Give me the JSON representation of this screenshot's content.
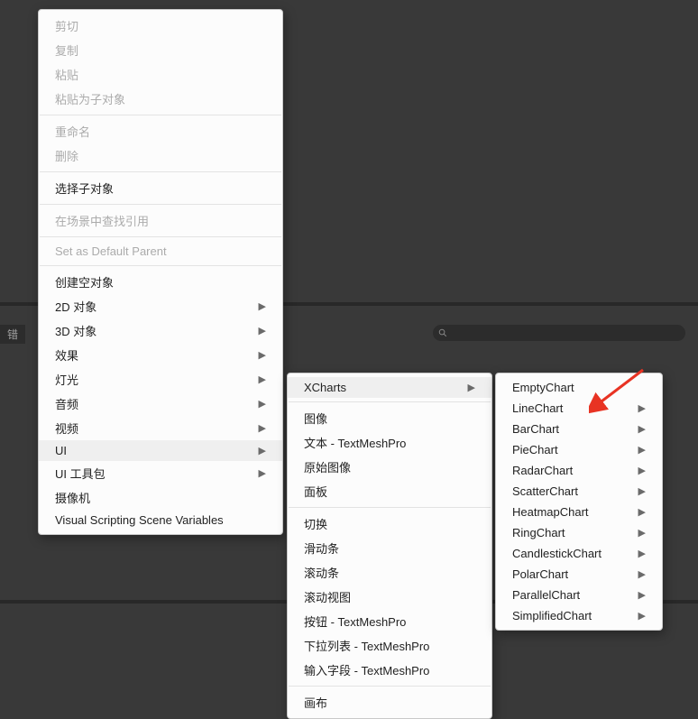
{
  "background": {
    "tab_label": "错",
    "search_placeholder": ""
  },
  "menu1": {
    "groups": [
      [
        {
          "label": "剪切",
          "disabled": true,
          "arrow": false
        },
        {
          "label": "复制",
          "disabled": true,
          "arrow": false
        },
        {
          "label": "粘贴",
          "disabled": true,
          "arrow": false
        },
        {
          "label": "粘贴为子对象",
          "disabled": true,
          "arrow": false
        }
      ],
      [
        {
          "label": "重命名",
          "disabled": true,
          "arrow": false
        },
        {
          "label": "删除",
          "disabled": true,
          "arrow": false
        }
      ],
      [
        {
          "label": "选择子对象",
          "disabled": false,
          "arrow": false
        }
      ],
      [
        {
          "label": "在场景中查找引用",
          "disabled": true,
          "arrow": false
        }
      ],
      [
        {
          "label": "Set as Default Parent",
          "disabled": true,
          "arrow": false
        }
      ],
      [
        {
          "label": "创建空对象",
          "disabled": false,
          "arrow": false
        },
        {
          "label": "2D 对象",
          "disabled": false,
          "arrow": true
        },
        {
          "label": "3D 对象",
          "disabled": false,
          "arrow": true
        },
        {
          "label": "效果",
          "disabled": false,
          "arrow": true
        },
        {
          "label": "灯光",
          "disabled": false,
          "arrow": true
        },
        {
          "label": "音频",
          "disabled": false,
          "arrow": true
        },
        {
          "label": "视频",
          "disabled": false,
          "arrow": true
        },
        {
          "label": "UI",
          "disabled": false,
          "arrow": true,
          "highlight": true
        },
        {
          "label": "UI 工具包",
          "disabled": false,
          "arrow": true
        },
        {
          "label": "摄像机",
          "disabled": false,
          "arrow": false
        },
        {
          "label": "Visual Scripting Scene Variables",
          "disabled": false,
          "arrow": false
        }
      ]
    ]
  },
  "menu2": {
    "groups": [
      [
        {
          "label": "XCharts",
          "disabled": false,
          "arrow": true,
          "highlight": true
        }
      ],
      [
        {
          "label": "图像",
          "disabled": false,
          "arrow": false
        },
        {
          "label": "文本 - TextMeshPro",
          "disabled": false,
          "arrow": false
        },
        {
          "label": "原始图像",
          "disabled": false,
          "arrow": false
        },
        {
          "label": "面板",
          "disabled": false,
          "arrow": false
        }
      ],
      [
        {
          "label": "切换",
          "disabled": false,
          "arrow": false
        },
        {
          "label": "滑动条",
          "disabled": false,
          "arrow": false
        },
        {
          "label": "滚动条",
          "disabled": false,
          "arrow": false
        },
        {
          "label": "滚动视图",
          "disabled": false,
          "arrow": false
        },
        {
          "label": "按钮 - TextMeshPro",
          "disabled": false,
          "arrow": false
        },
        {
          "label": "下拉列表 - TextMeshPro",
          "disabled": false,
          "arrow": false
        },
        {
          "label": "输入字段 - TextMeshPro",
          "disabled": false,
          "arrow": false
        }
      ],
      [
        {
          "label": "画布",
          "disabled": false,
          "arrow": false
        }
      ]
    ]
  },
  "menu3": {
    "items": [
      {
        "label": "EmptyChart",
        "arrow": false
      },
      {
        "label": "LineChart",
        "arrow": true
      },
      {
        "label": "BarChart",
        "arrow": true
      },
      {
        "label": "PieChart",
        "arrow": true
      },
      {
        "label": "RadarChart",
        "arrow": true
      },
      {
        "label": "ScatterChart",
        "arrow": true
      },
      {
        "label": "HeatmapChart",
        "arrow": true
      },
      {
        "label": "RingChart",
        "arrow": true
      },
      {
        "label": "CandlestickChart",
        "arrow": true
      },
      {
        "label": "PolarChart",
        "arrow": true
      },
      {
        "label": "ParallelChart",
        "arrow": true
      },
      {
        "label": "SimplifiedChart",
        "arrow": true
      }
    ]
  },
  "arrow_color": "#e83323"
}
